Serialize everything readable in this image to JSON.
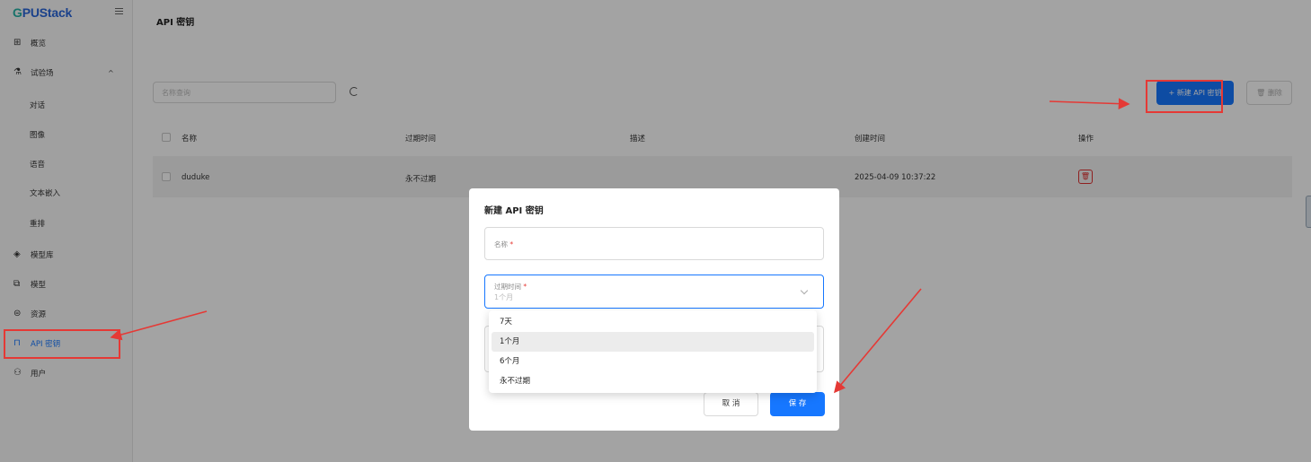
{
  "app": {
    "logo_prefix": "G",
    "logo_rest": "PUStack"
  },
  "sidebar": {
    "items": [
      {
        "label": "概览",
        "icon": "dashboard-icon"
      },
      {
        "label": "试验场",
        "icon": "flask-icon"
      },
      {
        "label": "对话"
      },
      {
        "label": "图像"
      },
      {
        "label": "语音"
      },
      {
        "label": "文本嵌入"
      },
      {
        "label": "重排"
      },
      {
        "label": "模型库",
        "icon": "layers-icon"
      },
      {
        "label": "模型",
        "icon": "model-icon"
      },
      {
        "label": "资源",
        "icon": "resource-icon"
      },
      {
        "label": "API 密钥",
        "icon": "lock-icon"
      },
      {
        "label": "用户",
        "icon": "users-icon"
      }
    ],
    "expand_glyph": "^"
  },
  "page": {
    "title": "API 密钥",
    "search_placeholder": "名称查询",
    "new_button": "+ 新建 API 密钥",
    "delete_button": "删除",
    "delete_icon": "🗑"
  },
  "table": {
    "headers": [
      "名称",
      "过期时间",
      "描述",
      "创建时间",
      "操作"
    ],
    "rows": [
      {
        "name": "duduke",
        "expiry": "永不过期",
        "description": "",
        "created": "2025-04-09 10:37:22"
      }
    ]
  },
  "modal": {
    "title": "新建 API 密钥",
    "name_label": "名称",
    "expiry_label": "过期时间",
    "required_mark": "*",
    "expiry_value": "1个月",
    "options": [
      "7天",
      "1个月",
      "6个月",
      "永不过期"
    ],
    "selected_option": "1个月",
    "cancel": "取 消",
    "save": "保 存"
  },
  "colors": {
    "primary": "#1677ff",
    "annotation": "#e53935",
    "danger": "#e03131"
  }
}
